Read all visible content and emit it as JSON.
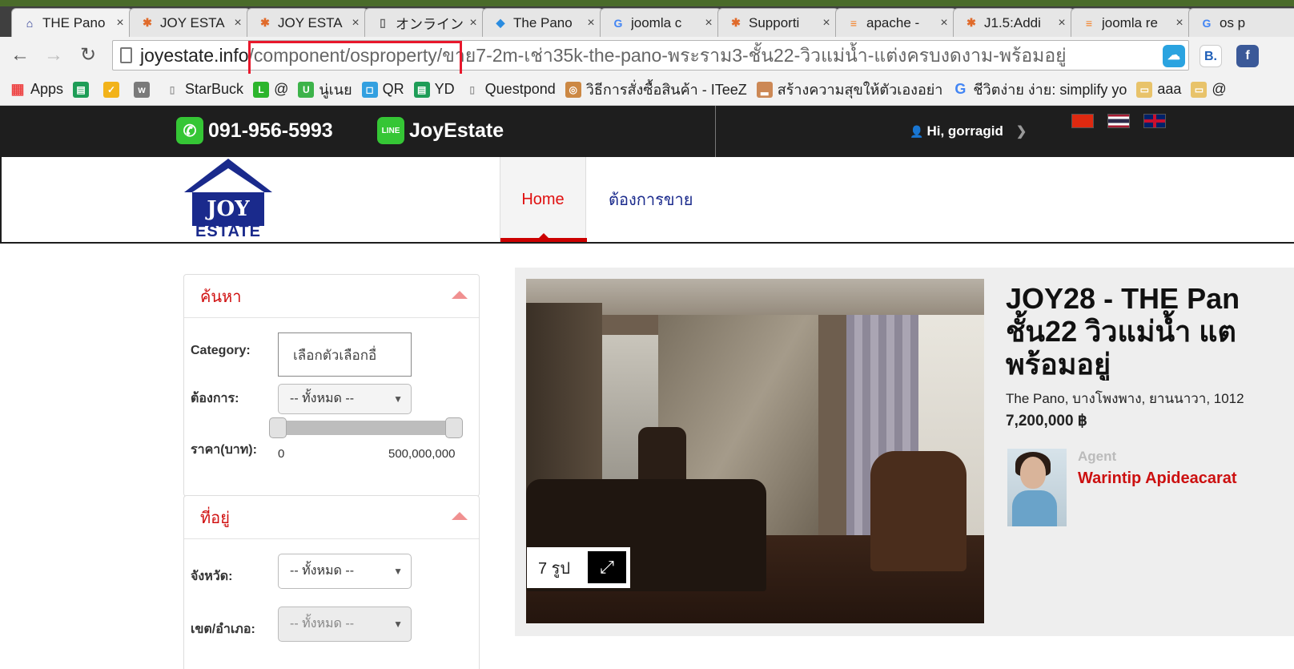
{
  "browser": {
    "tabs": [
      {
        "label": "THE Pano",
        "icon": "joy-estate-icon"
      },
      {
        "label": "JOY ESTA",
        "icon": "joomla-icon"
      },
      {
        "label": "JOY ESTA",
        "icon": "joomla-icon"
      },
      {
        "label": "オンライン",
        "icon": "page-icon"
      },
      {
        "label": "The Pano",
        "icon": "pin-icon"
      },
      {
        "label": "joomla c",
        "icon": "google-icon"
      },
      {
        "label": "Supporti",
        "icon": "joomla-icon"
      },
      {
        "label": "apache -",
        "icon": "stackoverflow-icon"
      },
      {
        "label": "J1.5:Addi",
        "icon": "joomla-icon"
      },
      {
        "label": "joomla re",
        "icon": "stackoverflow-icon"
      },
      {
        "label": "os p",
        "icon": "google-icon"
      }
    ],
    "address": {
      "host": "joyestate.info",
      "path": "/component/osproperty/ขาย7-2m-เช่า35k-the-pano-พระราม3-ชั้น22-วิวแม่น้ำ-แต่งครบงดงาม-พร้อมอยู่"
    },
    "extensions": [
      {
        "label": "",
        "color": "#2aa3e0"
      },
      {
        "label": "B.",
        "color": "#1f5fb8"
      },
      {
        "label": "f",
        "color": "#3b5998"
      }
    ],
    "bookmarks": [
      {
        "label": "Apps",
        "icon": "apps-grid-icon",
        "color": "#e44"
      },
      {
        "label": "",
        "icon": "sheets-icon",
        "color": "#1e9d57"
      },
      {
        "label": "",
        "icon": "check-icon",
        "color": "#f2b31a"
      },
      {
        "label": "",
        "icon": "wm-icon",
        "color": "#7a7a7a"
      },
      {
        "label": "StarBuck",
        "icon": "page-icon",
        "color": "#999"
      },
      {
        "label": "@",
        "icon": "line-icon",
        "color": "#2cb52c"
      },
      {
        "label": "นู่เนย",
        "icon": "u-icon",
        "color": "#3db34a"
      },
      {
        "label": "QR",
        "icon": "qr-icon",
        "color": "#33a0e0"
      },
      {
        "label": "YD",
        "icon": "sheets-icon",
        "color": "#1e9d57"
      },
      {
        "label": "Questpond",
        "icon": "page-icon",
        "color": "#999"
      },
      {
        "label": "วิธีการสั่งซื้อสินค้า - ITeeZ",
        "icon": "globe-icon",
        "color": "#c84"
      },
      {
        "label": "สร้างความสุขให้ตัวเองอย่า",
        "icon": "chart-icon",
        "color": "#c85"
      },
      {
        "label": "ชีวิตง่าย ง่าย: simplify yo",
        "icon": "google-icon",
        "color": "#4285f4"
      },
      {
        "label": "aaa",
        "icon": "folder-icon",
        "color": "#e8c36a"
      },
      {
        "label": "@",
        "icon": "folder-icon",
        "color": "#e8c36a"
      }
    ]
  },
  "site": {
    "phone": "091-956-5993",
    "line_id": "JoyEstate",
    "greeting": "Hi, gorragid",
    "logo": {
      "top": "JOY",
      "bottom": "ESTATE"
    },
    "nav": {
      "home": "Home",
      "sell": "ต้องการขาย"
    }
  },
  "sidebar": {
    "search": {
      "title": "ค้นหา",
      "category_label": "Category:",
      "category_value": "เลือกตัวเลือกอื่",
      "want_label": "ต้องการ:",
      "want_value": "-- ทั้งหมด --",
      "price_label": "ราคา(บาท):",
      "price_min": "0",
      "price_max": "500,000,000"
    },
    "location": {
      "title": "ที่อยู่",
      "province_label": "จังหวัด:",
      "province_value": "-- ทั้งหมด --",
      "district_label": "เขต/อำเภอ:",
      "district_value": "-- ทั้งหมด --"
    }
  },
  "listing": {
    "title_line1": "JOY28 - THE Pan",
    "title_line2": "ชั้น22 วิวแม่น้ำ แต",
    "title_line3": "พร้อมอยู่",
    "address": "The Pano, บางโพงพาง, ยานนาวา, 1012",
    "price": "7,200,000 ฿",
    "photo_count": "7 รูป",
    "agent_label": "Agent",
    "agent_name": "Warintip Apideacarat"
  }
}
